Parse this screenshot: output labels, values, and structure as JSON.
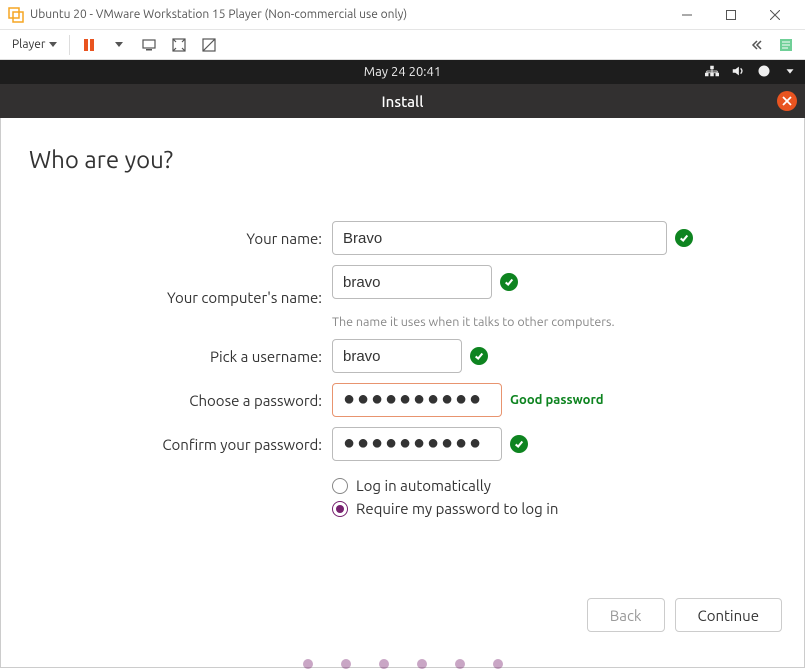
{
  "window": {
    "title": "Ubuntu 20 - VMware Workstation 15 Player (Non-commercial use only)"
  },
  "vmtoolbar": {
    "player_label": "Player"
  },
  "ubuntu": {
    "clock": "May 24  20:41"
  },
  "installer": {
    "header": "Install",
    "heading": "Who are you?",
    "labels": {
      "name": "Your name:",
      "computer": "Your computer's name:",
      "username": "Pick a username:",
      "password": "Choose a password:",
      "confirm": "Confirm your password:"
    },
    "values": {
      "name": "Bravo",
      "computer": "bravo",
      "username": "bravo",
      "password": "●●●●●●●●●●",
      "confirm": "●●●●●●●●●●"
    },
    "computer_hint": "The name it uses when it talks to other computers.",
    "password_strength": "Good password",
    "radio_auto": "Log in automatically",
    "radio_pwd": "Require my password to log in",
    "back": "Back",
    "continue": "Continue"
  }
}
